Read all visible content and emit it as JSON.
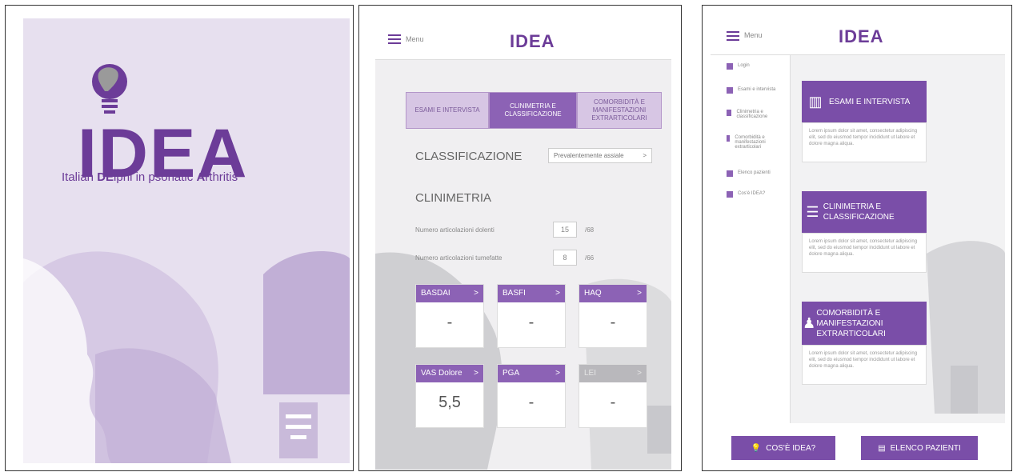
{
  "splash": {
    "logo_text": "IDEA",
    "tagline_parts": [
      "Italian ",
      "DE",
      "lphi in psoriatic ",
      "A",
      "rthritis"
    ]
  },
  "screen2": {
    "menu_label": "Menu",
    "logo_text": "IDEA",
    "tabs": [
      {
        "label": "ESAMI E INTERVISTA",
        "active": false
      },
      {
        "label": "CLINIMETRIA E CLASSIFICAZIONE",
        "active": true
      },
      {
        "label": "COMORBIDITÀ E MANIFESTAZIONI EXTRARTICOLARI",
        "active": false
      }
    ],
    "classificazione_label": "CLASSIFICAZIONE",
    "classificazione_value": "Prevalentemente assiale",
    "clinimetria_label": "CLINIMETRIA",
    "fields": [
      {
        "label": "Numero articolazioni dolenti",
        "value": "15",
        "max": "/68"
      },
      {
        "label": "Numero articolazioni tumefatte",
        "value": "8",
        "max": "/66"
      }
    ],
    "cards": [
      {
        "title": "BASDAI",
        "value": "-",
        "enabled": true
      },
      {
        "title": "BASFI",
        "value": "-",
        "enabled": true
      },
      {
        "title": "HAQ",
        "value": "-",
        "enabled": true
      },
      {
        "title": "VAS Dolore",
        "value": "5,5",
        "enabled": true
      },
      {
        "title": "PGA",
        "value": "-",
        "enabled": true
      },
      {
        "title": "LEI",
        "value": "-",
        "enabled": false
      }
    ],
    "chevron": ">"
  },
  "screen3": {
    "menu_label": "Menu",
    "logo_text": "IDEA",
    "sidebar": [
      {
        "label": "Login",
        "icon": "user-icon"
      },
      {
        "label": "Esami e intervista",
        "icon": "chart-icon"
      },
      {
        "label": "Clinimetria e classificazione",
        "icon": "list-icon"
      },
      {
        "label": "Comorbidità e manifestazioni extrarticolari",
        "icon": "person-icon"
      },
      {
        "label": "Elenco pazienti",
        "icon": "id-card-icon"
      },
      {
        "label": "Cos'è IDEA?",
        "icon": "bulb-icon"
      }
    ],
    "tiles": [
      {
        "title": "ESAMI E INTERVISTA",
        "desc": "Lorem ipsum dolor sit amet, consectetur adipiscing elit, sed do eiusmod tempor incididunt ut labore et dolore magna aliqua."
      },
      {
        "title": "CLINIMETRIA E CLASSIFICAZIONE",
        "desc": "Lorem ipsum dolor sit amet, consectetur adipiscing elit, sed do eiusmod tempor incididunt ut labore et dolore magna aliqua."
      },
      {
        "title": "COMORBIDITÀ E MANIFESTAZIONI EXTRARTICOLARI",
        "desc": "Lorem ipsum dolor sit amet, consectetur adipiscing elit, sed do eiusmod tempor incididunt ut labore et dolore magna aliqua."
      }
    ],
    "buttons": {
      "cos_e_idea": "COS'È IDEA?",
      "elenco_pazienti": "ELENCO PAZIENTI"
    }
  },
  "colors": {
    "accent": "#7a4ea8",
    "accent_light": "#d7c6e4",
    "background_light": "#e7e0ef"
  }
}
